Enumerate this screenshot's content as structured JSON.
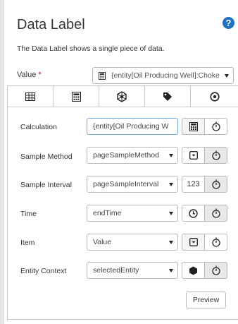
{
  "panel": {
    "title": "Data Label",
    "help_icon": "question-circle-icon",
    "description": "The Data Label shows a single piece of data.",
    "value_label": "Value",
    "required_marker": "*",
    "value_selected": "{entity[Oil Producing Well]:Choke",
    "accent_color": "#1f74c4"
  },
  "tabs": [
    {
      "icon": "table-icon"
    },
    {
      "icon": "calculator-icon",
      "active": true
    },
    {
      "icon": "hexagon-network-icon"
    },
    {
      "icon": "tag-icon"
    },
    {
      "icon": "target-circle-icon"
    }
  ],
  "rows": [
    {
      "label": "Calculation",
      "value": "{entity[Oil Producing W",
      "left_button": "calculator-icon"
    },
    {
      "label": "Sample Method",
      "value": "pageSampleMethod",
      "left_button": "dropdown-box-icon"
    },
    {
      "label": "Sample Interval",
      "value": "pageSampleInterval",
      "left_button_text": "123"
    },
    {
      "label": "Time",
      "value": "endTime",
      "left_button": "clock-icon"
    },
    {
      "label": "Item",
      "value": "Value",
      "left_button": "dropdown-box-icon"
    },
    {
      "label": "Entity Context",
      "value": "selectedEntity",
      "left_button": "hexagon-icon"
    }
  ],
  "preview_label": "Preview"
}
